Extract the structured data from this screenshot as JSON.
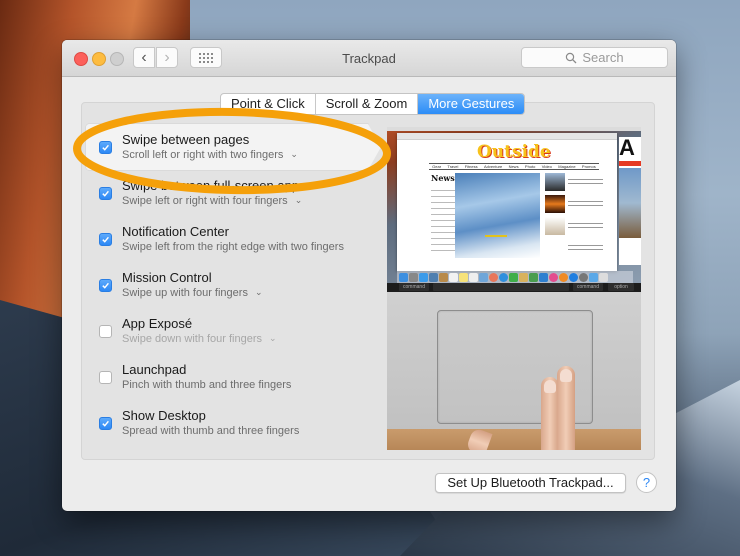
{
  "window": {
    "title": "Trackpad",
    "search_placeholder": "Search"
  },
  "toolbar": {
    "back_icon": "chevron-left",
    "forward_icon": "chevron-right",
    "show_all_icon": "grid"
  },
  "tabs": [
    {
      "label": "Point & Click",
      "active": false
    },
    {
      "label": "Scroll & Zoom",
      "active": false
    },
    {
      "label": "More Gestures",
      "active": true
    }
  ],
  "gestures": [
    {
      "title": "Swipe between pages",
      "subtitle": "Scroll left or right with two fingers",
      "checked": true,
      "has_dropdown": true,
      "selected": true,
      "dimmed": false
    },
    {
      "title": "Swipe between full-screen apps",
      "subtitle": "Swipe left or right with four fingers",
      "checked": true,
      "has_dropdown": true,
      "selected": false,
      "dimmed": false
    },
    {
      "title": "Notification Center",
      "subtitle": "Swipe left from the right edge with two fingers",
      "checked": true,
      "has_dropdown": false,
      "selected": false,
      "dimmed": false
    },
    {
      "title": "Mission Control",
      "subtitle": "Swipe up with four fingers",
      "checked": true,
      "has_dropdown": true,
      "selected": false,
      "dimmed": false
    },
    {
      "title": "App Exposé",
      "subtitle": "Swipe down with four fingers",
      "checked": false,
      "has_dropdown": true,
      "selected": false,
      "dimmed": true
    },
    {
      "title": "Launchpad",
      "subtitle": "Pinch with thumb and three fingers",
      "checked": false,
      "has_dropdown": false,
      "selected": false,
      "dimmed": false
    },
    {
      "title": "Show Desktop",
      "subtitle": "Spread with thumb and three fingers",
      "checked": true,
      "has_dropdown": false,
      "selected": false,
      "dimmed": false
    }
  ],
  "preview": {
    "site_logo": "Outside",
    "site_nav": [
      "Gear",
      "Travel",
      "Fitness",
      "Adventure",
      "News",
      "Photo",
      "Video",
      "Magazine",
      "Promos"
    ],
    "news_heading": "News",
    "ad_letter": "A",
    "keys": {
      "left_command": "command",
      "right_command": "command",
      "option": "option"
    }
  },
  "footer": {
    "bluetooth_button": "Set Up Bluetooth Trackpad...",
    "help_label": "?"
  },
  "annotation": {
    "color": "#f5a00a"
  },
  "colors": {
    "accent": "#2b8cf7",
    "close": "#fc605b",
    "minimize": "#fdbc40"
  }
}
